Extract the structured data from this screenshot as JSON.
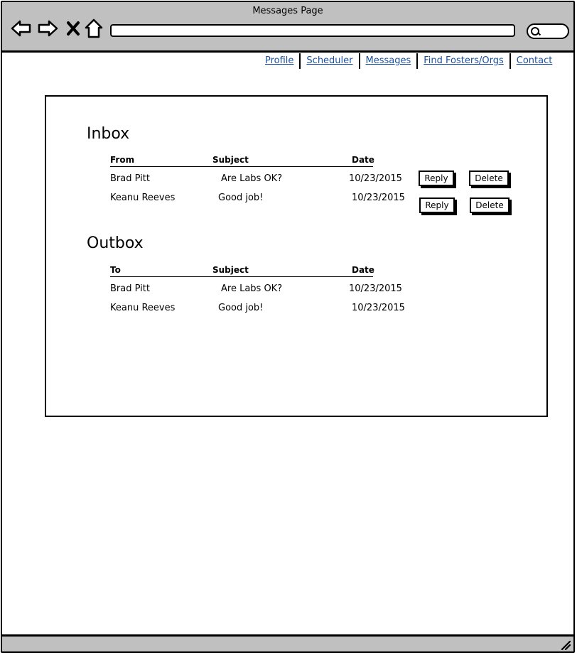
{
  "window": {
    "title": "Messages Page"
  },
  "toolbar": {
    "back_icon": "arrow-left-icon",
    "forward_icon": "arrow-right-icon",
    "stop_icon": "close-icon",
    "home_icon": "home-icon",
    "url_value": "",
    "search_icon": "search-icon"
  },
  "nav": {
    "items": [
      {
        "label": "Profile"
      },
      {
        "label": "Scheduler"
      },
      {
        "label": "Messages"
      },
      {
        "label": "Find Fosters/Orgs"
      },
      {
        "label": "Contact"
      }
    ]
  },
  "inbox": {
    "title": "Inbox",
    "headers": {
      "from": "From",
      "subject": "Subject",
      "date": "Date"
    },
    "rows": [
      {
        "from": "Brad Pitt",
        "subject": "Are Labs OK?",
        "date": "10/23/2015",
        "reply_label": "Reply",
        "delete_label": "Delete"
      },
      {
        "from": "Keanu Reeves",
        "subject": "Good job!",
        "date": "10/23/2015",
        "reply_label": "Reply",
        "delete_label": "Delete"
      }
    ]
  },
  "outbox": {
    "title": "Outbox",
    "headers": {
      "to": "To",
      "subject": "Subject",
      "date": "Date"
    },
    "rows": [
      {
        "to": "Brad Pitt",
        "subject": "Are Labs OK?",
        "date": "10/23/2015"
      },
      {
        "to": "Keanu Reeves",
        "subject": "Good job!",
        "date": "10/23/2015"
      }
    ]
  },
  "colors": {
    "chrome": "#c0c0c0",
    "link": "#1a4fa0",
    "border": "#000000"
  }
}
